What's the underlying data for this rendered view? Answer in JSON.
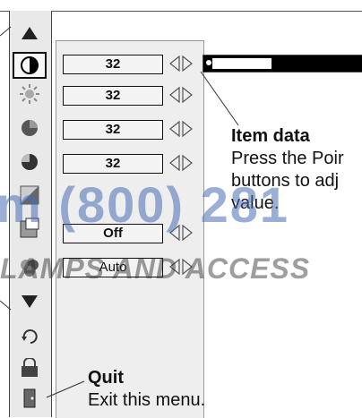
{
  "menu": {
    "icons": [
      "up-arrow-icon",
      "contrast-icon",
      "brightness-icon",
      "color-icon",
      "tint-icon",
      "sharpness-icon",
      "gamma-icon",
      "color-management-icon",
      "down-arrow-icon",
      "reset-icon",
      "store-icon",
      "quit-icon"
    ],
    "items": [
      {
        "value": "32"
      },
      {
        "value": "32"
      },
      {
        "value": "32"
      },
      {
        "value": "32"
      },
      {
        "value": "Off"
      },
      {
        "value": "Auto"
      }
    ]
  },
  "slider": {
    "fraction": 0.4
  },
  "callouts": {
    "item_data_title": "Item data",
    "item_data_line1": "Press the Poir",
    "item_data_line2": "buttons to adj",
    "item_data_line3": "value.",
    "quit_title": "Quit",
    "quit_text": "Exit this menu."
  },
  "watermark": {
    "phone": "m (800) 281",
    "brand": "LAMPS AND ACCESS"
  },
  "colors": {
    "watermark_blue": "#4a6db5",
    "panel_bg": "#eeeeee",
    "slider_bg": "#000000"
  }
}
